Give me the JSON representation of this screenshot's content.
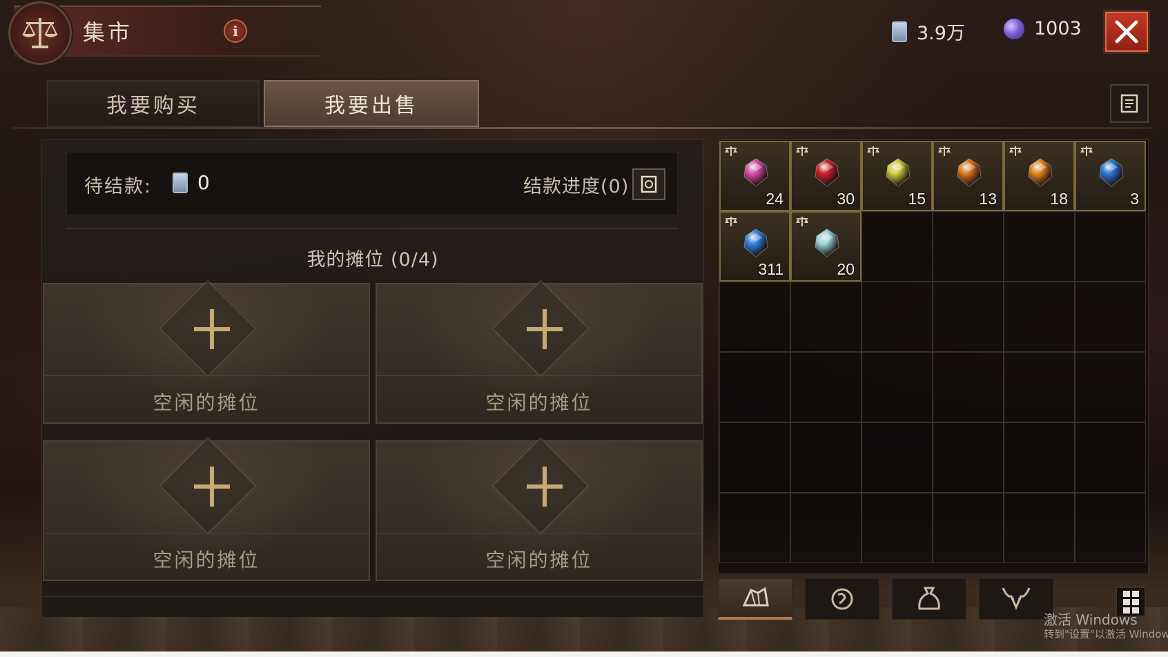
{
  "header": {
    "title": "集市",
    "info_glyph": "i",
    "currency_scroll": "3.9万",
    "currency_orb": "1003"
  },
  "tabs": [
    {
      "label": "我要购买",
      "active": false
    },
    {
      "label": "我要出售",
      "active": true
    }
  ],
  "pending": {
    "label": "待结款:",
    "value": "0",
    "progress_label": "结款进度(0)"
  },
  "booths": {
    "title": "我的摊位 (0/4)",
    "slots": [
      {
        "label": "空闲的摊位"
      },
      {
        "label": "空闲的摊位"
      },
      {
        "label": "空闲的摊位"
      },
      {
        "label": "空闲的摊位"
      }
    ]
  },
  "inventory": {
    "items": [
      {
        "gem": "pink-gem",
        "count": "24",
        "color": "#e04fb0"
      },
      {
        "gem": "red-gem",
        "count": "30",
        "color": "#d0222a"
      },
      {
        "gem": "yellow-gem",
        "count": "15",
        "color": "#d8d040"
      },
      {
        "gem": "orange-gem",
        "count": "13",
        "color": "#e07a20"
      },
      {
        "gem": "orange-gem",
        "count": "18",
        "color": "#e48a22"
      },
      {
        "gem": "blue-gem",
        "count": "3",
        "color": "#2a7ae0"
      },
      {
        "gem": "blue-gem",
        "count": "311",
        "color": "#2f86e8"
      },
      {
        "gem": "cyan-gem",
        "count": "20",
        "color": "#9ad8e0"
      }
    ],
    "tabs": [
      {
        "icon": "gem-category-icon",
        "active": true
      },
      {
        "icon": "rune-category-icon",
        "active": false
      },
      {
        "icon": "bag-category-icon",
        "active": false
      },
      {
        "icon": "demon-category-icon",
        "active": false
      }
    ]
  },
  "watermark": {
    "line1": "激活 Windows",
    "line2": "转到\"设置\"以激活 Window"
  },
  "colors": {
    "accent_gold": "#c9a874",
    "close_red": "#c43a24"
  }
}
